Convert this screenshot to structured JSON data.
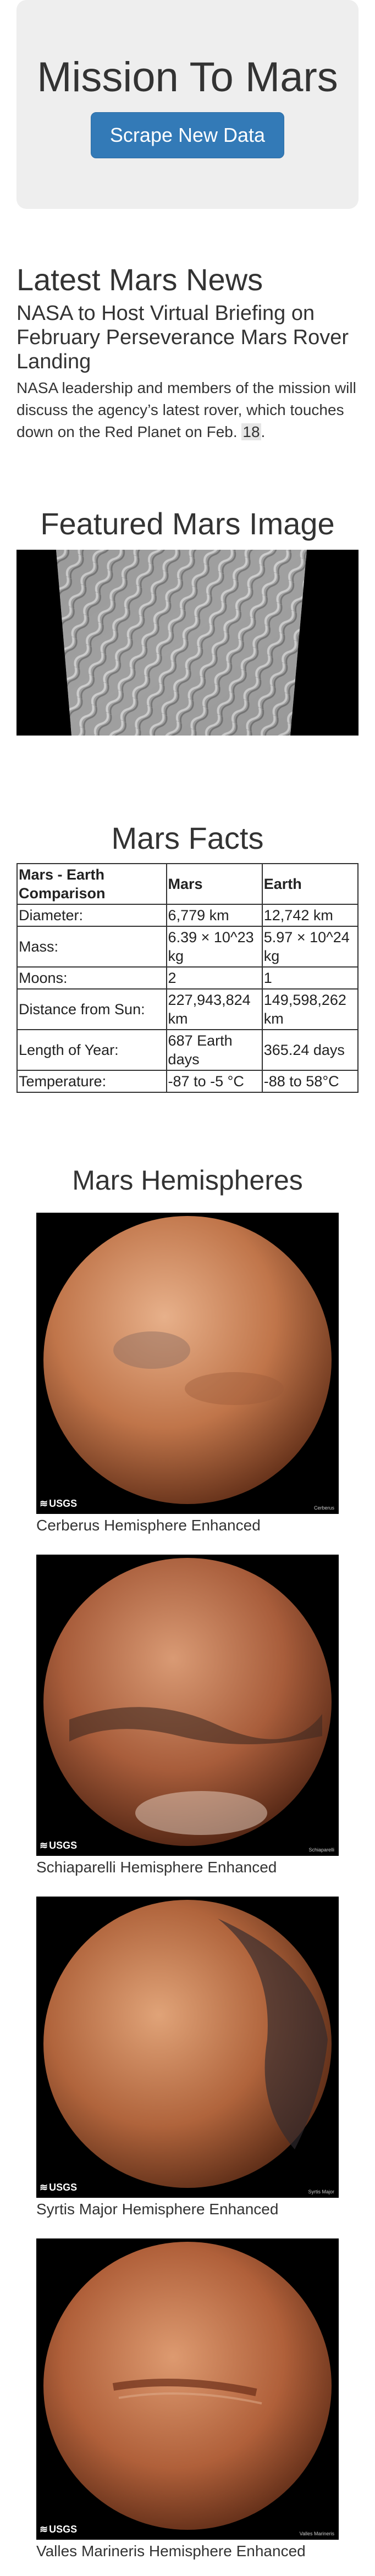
{
  "header": {
    "title": "Mission To Mars",
    "scrape_button": "Scrape New Data"
  },
  "news": {
    "section_title": "Latest Mars News",
    "headline": "NASA to Host Virtual Briefing on February Perseverance Mars Rover Landing",
    "teaser_before": "NASA leadership and members of the mission will discuss the agency’s latest rover, which touches down on the Red Planet on Feb. ",
    "teaser_highlight": "18",
    "teaser_after": "."
  },
  "featured": {
    "section_title": "Featured Mars Image"
  },
  "facts": {
    "section_title": "Mars Facts",
    "columns": [
      "Mars - Earth Comparison",
      "Mars",
      "Earth"
    ],
    "rows": [
      [
        "Diameter:",
        "6,779 km",
        "12,742 km"
      ],
      [
        "Mass:",
        "6.39 × 10^23 kg",
        "5.97 × 10^24 kg"
      ],
      [
        "Moons:",
        "2",
        "1"
      ],
      [
        "Distance from Sun:",
        "227,943,824 km",
        "149,598,262 km"
      ],
      [
        "Length of Year:",
        "687 Earth days",
        "365.24 days"
      ],
      [
        "Temperature:",
        "-87 to -5 °C",
        "-88 to 58°C"
      ]
    ]
  },
  "hemispheres": {
    "section_title": "Mars Hemispheres",
    "logo_text": "USGS",
    "items": [
      {
        "caption": "Cerberus Hemisphere Enhanced",
        "credit": "Cerberus"
      },
      {
        "caption": "Schiaparelli Hemisphere Enhanced",
        "credit": "Schiaparelli"
      },
      {
        "caption": "Syrtis Major Hemisphere Enhanced",
        "credit": "Syrtis Major"
      },
      {
        "caption": "Valles Marineris Hemisphere Enhanced",
        "credit": "Valles Marineris"
      }
    ]
  },
  "colors": {
    "button_bg": "#337ab7",
    "jumbotron_bg": "#eeeeee",
    "text": "#333333"
  }
}
